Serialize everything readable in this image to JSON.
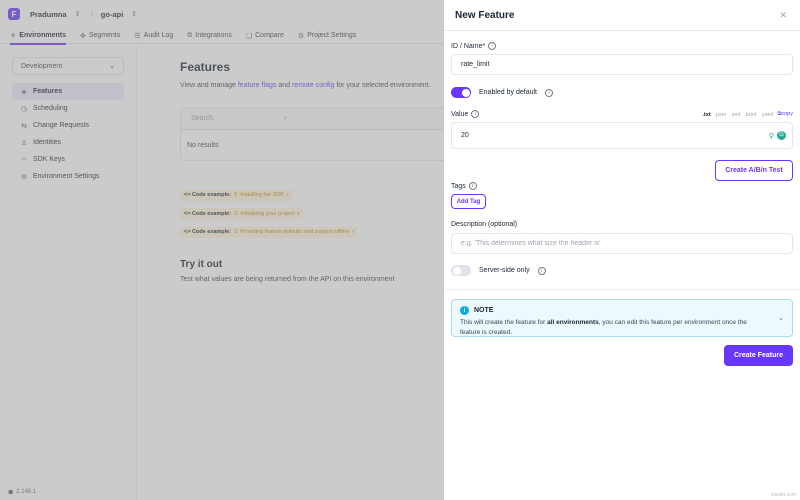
{
  "topbar": {
    "org": "Pradumna",
    "project": "go-api"
  },
  "nav_tabs": [
    {
      "label": "Environments",
      "icon": "leaf-icon"
    },
    {
      "label": "Segments",
      "icon": "segments-icon"
    },
    {
      "label": "Audit Log",
      "icon": "list-icon"
    },
    {
      "label": "Integrations",
      "icon": "integrations-icon"
    },
    {
      "label": "Compare",
      "icon": "compare-icon"
    },
    {
      "label": "Project Settings",
      "icon": "gear-icon"
    }
  ],
  "sidebar": {
    "environment": "Development",
    "items": [
      {
        "label": "Features",
        "icon": "features-icon"
      },
      {
        "label": "Scheduling",
        "icon": "clock-icon"
      },
      {
        "label": "Change Requests",
        "icon": "change-requests-icon"
      },
      {
        "label": "Identities",
        "icon": "user-icon"
      },
      {
        "label": "SDK Keys",
        "icon": "code-icon"
      },
      {
        "label": "Environment Settings",
        "icon": "gear-icon"
      }
    ],
    "version": "2.148.1"
  },
  "main": {
    "title": "Features",
    "subtitle_pre": "View and manage ",
    "link1": "feature flags",
    "subtitle_mid": " and ",
    "link2": "remote config",
    "subtitle_post": " for your selected environment.",
    "search_placeholder": "Search",
    "no_results": "No results",
    "code_prefix": "<> Code example:",
    "code_examples": [
      "1: Installing the SDK",
      "2: Initialising your project",
      "3: Providing feature defaults and support offline"
    ],
    "try_title": "Try it out",
    "try_desc": "Test what values are being returned from the API on this environment"
  },
  "panel": {
    "title": "New Feature",
    "id_label": "ID / Name*",
    "id_value": "rate_limit",
    "enabled_label": "Enabled by default",
    "enabled": true,
    "value_label": "Value",
    "formats": [
      ".txt",
      ".json",
      ".xml",
      ".toml",
      ".yaml"
    ],
    "copy_label": "copy",
    "value": "20",
    "ab_button": "Create A/B/n Test",
    "tags_label": "Tags",
    "add_tag": "Add Tag",
    "desc_label": "Description (optional)",
    "desc_placeholder": "e.g. 'This determines what size the header is'",
    "server_label": "Server-side only",
    "server_side": false,
    "note_title": "NOTE",
    "note_pre": "This will create the feature for ",
    "note_bold": "all environments",
    "note_post": ", you can edit this feature per environment once the feature is created.",
    "create_button": "Create Feature"
  },
  "watermark": "wsxdn.com",
  "colors": {
    "accent": "#6837fc",
    "info": "#0aaddf"
  }
}
